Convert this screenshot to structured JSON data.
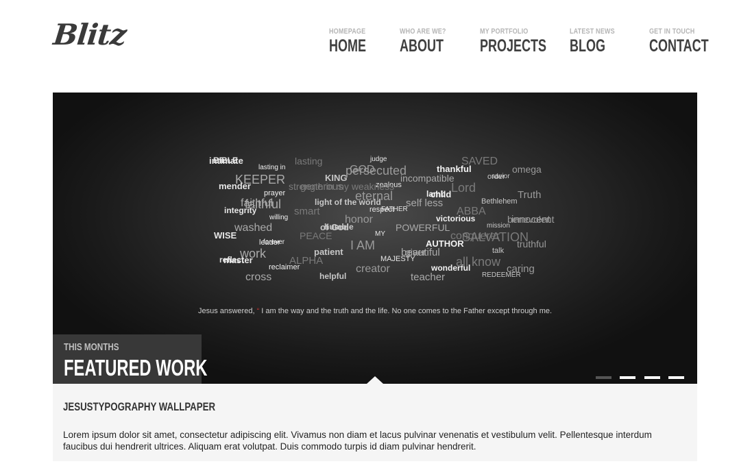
{
  "logo": {
    "text": "Blitz"
  },
  "nav": [
    {
      "sub": "HOMEPAGE",
      "label": "HOME"
    },
    {
      "sub": "WHO ARE WE?",
      "label": "ABOUT"
    },
    {
      "sub": "MY PORTFOLIO",
      "label": "PROJECTS"
    },
    {
      "sub": "LATEST NEWS",
      "label": "BLOG"
    },
    {
      "sub": "GET IN TOUCH",
      "label": "CONTACT"
    }
  ],
  "slide": {
    "quote": {
      "prefix": "Jesus answered,",
      "body": "I am the way and the truth and the life. No one comes to the Father except through me."
    },
    "words": [
      "intimate",
      "persecuted",
      "order",
      "generous",
      "lamb",
      "faithful",
      "FATHER",
      "benevolent",
      "of God",
      "SALVATION",
      "leader",
      "beautiful",
      "reflect",
      "creator",
      "REDEEMER",
      "lasting",
      "thankful",
      "KEEPER",
      "zealous",
      "Truth",
      "light of the world",
      "ABBA",
      "willing",
      "POWERFUL",
      "WISE",
      "I AM",
      "talk",
      "ALPHA",
      "wonderful",
      "cross",
      "judge",
      "omega",
      "KING",
      "Lord",
      "prayer",
      "self less",
      "integrity",
      "honor",
      "mission",
      "PEACE",
      "AUTHOR",
      "work",
      "MAJESTY",
      "caring",
      "helpful",
      "SAVED",
      "lasting in",
      "incompatible",
      "mender",
      "eternal",
      "Bethlehem",
      "smart",
      "victorious",
      "washed",
      "MY",
      "truthful",
      "patient",
      "all know",
      "reclaimer",
      "teacher",
      "BIBLE",
      "GOD",
      "savior",
      "strength in my weakness",
      "child",
      "faithful",
      "respect",
      "innocent",
      "humble",
      "conquerer",
      "forever",
      "giver",
      "master"
    ]
  },
  "featured": {
    "small": "THIS MONTHS",
    "big": "FEATURED WORK"
  },
  "slider_dots": 4,
  "caption": {
    "title": "JESUSTYPOGRAPHY WALLPAPER",
    "text": "Lorem ipsum dolor sit amet, consectetur adipiscing elit. Vivamus non diam et lacus pulvinar venenatis et vestibulum velit. Pellentesque interdum faucibus dui hendrerit ultrices. Aliquam erat volutpat. Duis commodo turpis id diam pulvinar hendrerit."
  },
  "colors": {
    "accent_quote": "#cc3333",
    "nav_main": "#3f3f3f",
    "nav_sub": "#b5b5b5",
    "caption_bg": "#f5f5f5"
  }
}
